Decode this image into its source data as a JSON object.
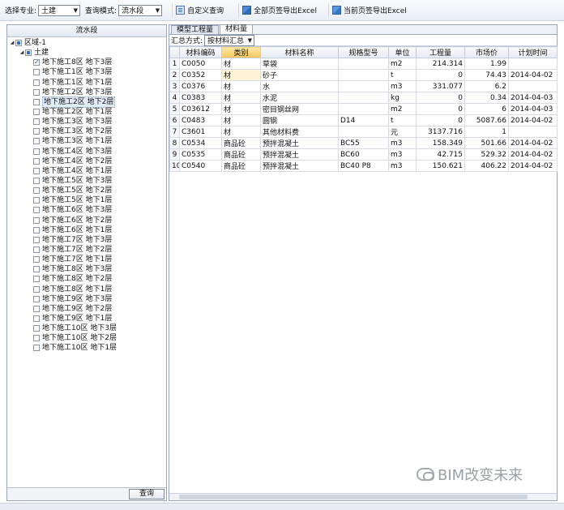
{
  "toolbar": {
    "major_label": "选择专业:",
    "major_value": "土建",
    "mode_label": "查询模式:",
    "mode_value": "流水段",
    "custom_query": "自定义查询",
    "export_all": "全部页签导出Excel",
    "export_current": "当前页签导出Excel"
  },
  "left": {
    "header": "流水段",
    "query_button": "查询",
    "root": "区域-1",
    "discipline": "土建",
    "items": [
      "地下施工8区 地下3层",
      "地下施工1区 地下3层",
      "地下施工1区 地下1层",
      "地下施工2区 地下3层",
      "地下施工2区 地下2层",
      "地下施工2区 地下1层",
      "地下施工3区 地下3层",
      "地下施工3区 地下2层",
      "地下施工3区 地下1层",
      "地下施工4区 地下3层",
      "地下施工4区 地下2层",
      "地下施工4区 地下1层",
      "地下施工5区 地下3层",
      "地下施工5区 地下2层",
      "地下施工5区 地下1层",
      "地下施工6区 地下3层",
      "地下施工6区 地下2层",
      "地下施工6区 地下1层",
      "地下施工7区 地下3层",
      "地下施工7区 地下2层",
      "地下施工7区 地下1层",
      "地下施工8区 地下3层",
      "地下施工8区 地下2层",
      "地下施工8区 地下1层",
      "地下施工9区 地下3层",
      "地下施工9区 地下2层",
      "地下施工9区 地下1层",
      "地下施工10区 地下3层",
      "地下施工10区 地下2层",
      "地下施工10区 地下1层"
    ]
  },
  "right": {
    "tabs": [
      "模型工程量",
      "材料量"
    ],
    "summary_label": "汇总方式:",
    "summary_value": "按材料汇总",
    "columns": [
      "材料编码",
      "类别",
      "材料名称",
      "规格型号",
      "单位",
      "工程量",
      "市场价",
      "计划时间"
    ],
    "rows": [
      [
        "C0050",
        "材",
        "草袋",
        "",
        "m2",
        "214.314",
        "1.99",
        ""
      ],
      [
        "C0352",
        "材",
        "砂子",
        "",
        "t",
        "0",
        "74.43",
        "2014-04-02"
      ],
      [
        "C0376",
        "材",
        "水",
        "",
        "m3",
        "331.077",
        "6.2",
        ""
      ],
      [
        "C0383",
        "材",
        "水泥",
        "",
        "kg",
        "0",
        "0.34",
        "2014-04-03"
      ],
      [
        "C03612",
        "材",
        "密目钢丝网",
        "",
        "m2",
        "0",
        "6",
        "2014-04-03"
      ],
      [
        "C0483",
        "材",
        "圆钢",
        "D14",
        "t",
        "0",
        "5087.66",
        "2014-04-02"
      ],
      [
        "C3601",
        "材",
        "其他材料费",
        "",
        "元",
        "3137.716",
        "1",
        ""
      ],
      [
        "C0534",
        "商品砼",
        "预拌混凝土",
        "BC55",
        "m3",
        "158.349",
        "501.66",
        "2014-04-02"
      ],
      [
        "C0535",
        "商品砼",
        "预拌混凝土",
        "BC60",
        "m3",
        "42.715",
        "529.32",
        "2014-04-02"
      ],
      [
        "C0540",
        "商品砼",
        "预拌混凝土",
        "BC40 P8",
        "m3",
        "150.621",
        "406.22",
        "2014-04-02"
      ]
    ]
  },
  "watermark": "BIM改变未来"
}
